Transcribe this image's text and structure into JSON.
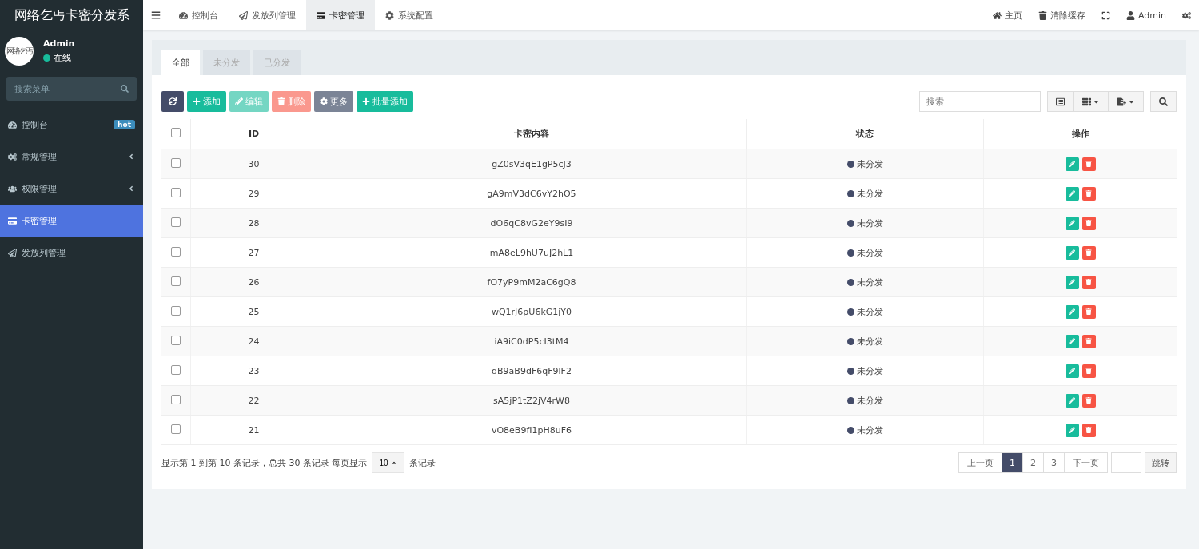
{
  "app_title": "网络乞丐卡密分发系",
  "user": {
    "avatar_text": "网络乞丐",
    "name": "Admin",
    "status": "在线",
    "online": true
  },
  "sidebar": {
    "search_placeholder": "搜索菜单",
    "items": [
      {
        "kind": "dashboard",
        "label": "控制台",
        "badge": "hot",
        "expandable": false,
        "selected": false
      },
      {
        "kind": "general",
        "label": "常规管理",
        "expandable": true,
        "selected": false
      },
      {
        "kind": "auth",
        "label": "权限管理",
        "expandable": true,
        "selected": false
      },
      {
        "kind": "card",
        "label": "卡密管理",
        "expandable": false,
        "selected": true
      },
      {
        "kind": "send",
        "label": "发放列管理",
        "expandable": false,
        "selected": false
      }
    ]
  },
  "topnav": {
    "tabs": [
      {
        "kind": "dashboard",
        "label": "控制台",
        "selected": false
      },
      {
        "kind": "send",
        "label": "发放列管理",
        "selected": false
      },
      {
        "kind": "card",
        "label": "卡密管理",
        "selected": true
      },
      {
        "kind": "config",
        "label": "系统配置",
        "selected": false
      }
    ],
    "right": [
      {
        "kind": "home",
        "label": "主页"
      },
      {
        "kind": "trash",
        "label": "清除缓存"
      },
      {
        "kind": "fullscreen"
      },
      {
        "kind": "user",
        "label": "Admin"
      },
      {
        "kind": "settings"
      }
    ]
  },
  "tabs": [
    {
      "label": "全部",
      "selected": true
    },
    {
      "label": "未分发",
      "selected": false
    },
    {
      "label": "已分发",
      "selected": false
    }
  ],
  "toolbar": [
    {
      "kind": "refresh",
      "disabled": false
    },
    {
      "kind": "add",
      "label": "添加",
      "disabled": false
    },
    {
      "kind": "edit",
      "label": "编辑",
      "disabled": true
    },
    {
      "kind": "delete",
      "label": "删除",
      "disabled": true
    },
    {
      "kind": "more",
      "label": "更多",
      "disabled": false
    },
    {
      "kind": "batch",
      "label": "批量添加",
      "disabled": false
    }
  ],
  "search_placeholder": "搜索",
  "table": {
    "columns": [
      "ID",
      "卡密内容",
      "状态",
      "操作"
    ],
    "all_checked": false,
    "rows": [
      {
        "checked": false,
        "id": "30",
        "content": "gZ0sV3qE1gP5cJ3",
        "status": "未分发"
      },
      {
        "checked": false,
        "id": "29",
        "content": "gA9mV3dC6vY2hQ5",
        "status": "未分发"
      },
      {
        "checked": false,
        "id": "28",
        "content": "dO6qC8vG2eY9sI9",
        "status": "未分发"
      },
      {
        "checked": false,
        "id": "27",
        "content": "mA8eL9hU7uJ2hL1",
        "status": "未分发"
      },
      {
        "checked": false,
        "id": "26",
        "content": "fO7yP9mM2aC6gQ8",
        "status": "未分发"
      },
      {
        "checked": false,
        "id": "25",
        "content": "wQ1rJ6pU6kG1jY0",
        "status": "未分发"
      },
      {
        "checked": false,
        "id": "24",
        "content": "iA9iC0dP5cI3tM4",
        "status": "未分发"
      },
      {
        "checked": false,
        "id": "23",
        "content": "dB9aB9dF6qF9lF2",
        "status": "未分发"
      },
      {
        "checked": false,
        "id": "22",
        "content": "sA5jP1tZ2jV4rW8",
        "status": "未分发"
      },
      {
        "checked": false,
        "id": "21",
        "content": "vO8eB9fI1pH8uF6",
        "status": "未分发"
      }
    ]
  },
  "pagination": {
    "summary": "显示第 1 到第 10 条记录，总共 30 条记录 每页显示",
    "page_size": "10",
    "suffix": "条记录",
    "prev": "上一页",
    "pages": [
      {
        "label": "1",
        "selected": true
      },
      {
        "label": "2",
        "selected": false
      },
      {
        "label": "3",
        "selected": false
      }
    ],
    "next": "下一页",
    "jump": "跳转"
  }
}
